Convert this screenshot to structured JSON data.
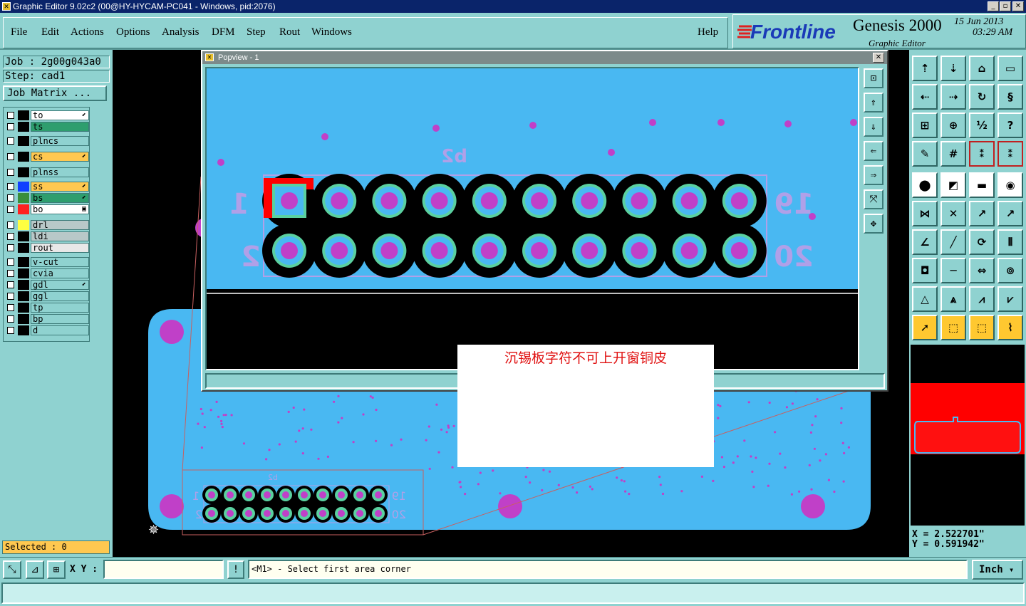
{
  "window": {
    "title": "Graphic Editor 9.02c2 (00@HY-HYCAM-PC041 - Windows, pid:2076)",
    "minimize_glyph": "_",
    "maximize_glyph": "▫",
    "close_glyph": "✕"
  },
  "menu": {
    "items": [
      "File",
      "Edit",
      "Actions",
      "Options",
      "Analysis",
      "DFM",
      "Step",
      "Rout",
      "Windows"
    ],
    "help": "Help"
  },
  "brand": {
    "logo": "Frontline",
    "product": "Genesis 2000",
    "subtitle": "Graphic Editor",
    "date": "15 Jun 2013",
    "time": "03:29 AM"
  },
  "job": {
    "job_label": "Job : 2g00g043a0",
    "step_label": "Step: cad1",
    "matrix_button": "Job Matrix ..."
  },
  "layers": [
    {
      "name": "to",
      "color": "#ffffff",
      "swatch": "#000000",
      "mark": "⬋"
    },
    {
      "name": "ts",
      "color": "#2e9e6e",
      "swatch": "#000000",
      "mark": ""
    },
    {
      "name": "plncs",
      "color": "#8fd2d0",
      "swatch": "#000000",
      "mark": ""
    },
    {
      "name": "cs",
      "color": "#ffc850",
      "swatch": "#000000",
      "mark": "⬋"
    },
    {
      "name": "plnss",
      "color": "#8fd2d0",
      "swatch": "#000000",
      "mark": ""
    },
    {
      "name": "ss",
      "color": "#ffc850",
      "swatch": "#1040ff",
      "mark": "⬋"
    },
    {
      "name": "bs",
      "color": "#2e9e6e",
      "swatch": "#3a8e3a",
      "mark": "⬋"
    },
    {
      "name": "bo",
      "color": "#ffffff",
      "swatch": "#ff2020",
      "mark": "▣"
    },
    {
      "name": "drl",
      "color": "#b8c8c8",
      "swatch": "#ffff40",
      "mark": ""
    },
    {
      "name": "ldi",
      "color": "#b8c8c8",
      "swatch": "#000000",
      "mark": ""
    },
    {
      "name": "rout",
      "color": "#e8e8e8",
      "swatch": "#000000",
      "mark": ""
    },
    {
      "name": "v-cut",
      "color": "#8fd2d0",
      "swatch": "#000000",
      "mark": ""
    },
    {
      "name": "cvia",
      "color": "#8fd2d0",
      "swatch": "#000000",
      "mark": ""
    },
    {
      "name": "gdl",
      "color": "#8fd2d0",
      "swatch": "#000000",
      "mark": "⬋"
    },
    {
      "name": "ggl",
      "color": "#8fd2d0",
      "swatch": "#000000",
      "mark": ""
    },
    {
      "name": "tp",
      "color": "#8fd2d0",
      "swatch": "#000000",
      "mark": ""
    },
    {
      "name": "bp",
      "color": "#8fd2d0",
      "swatch": "#000000",
      "mark": ""
    },
    {
      "name": "d",
      "color": "#8fd2d0",
      "swatch": "#000000",
      "mark": ""
    }
  ],
  "popup": {
    "title": "Popview - 1",
    "close_glyph": "✕",
    "board_label": "b2",
    "pin_label_left_top": "1",
    "pin_label_left_bottom": "2",
    "pin_label_right_top": "19",
    "pin_label_right_bottom": "20"
  },
  "main_board": {
    "board_label": "b2",
    "pin_label_left_top": "1",
    "pin_label_left_bottom": "2",
    "pin_label_right_top": "19",
    "pin_label_right_bottom": "20"
  },
  "note": {
    "text": "沉锡板字符不可上开窗铜皮"
  },
  "status": {
    "selected": "Selected : 0",
    "xy_label": "X Y :",
    "xy_value": "",
    "prompt": "<M1> - Select first area corner",
    "unit": "Inch",
    "x": "X = 2.522701\"",
    "y": "Y = 0.591942\""
  },
  "colors": {
    "panel": "#8fd2d0",
    "board": "#49b8f2",
    "pad": "#c040c8",
    "pad_ring": "#5ad0a0",
    "outline": "#b0a0e8",
    "mask_red": "#ff0000"
  }
}
